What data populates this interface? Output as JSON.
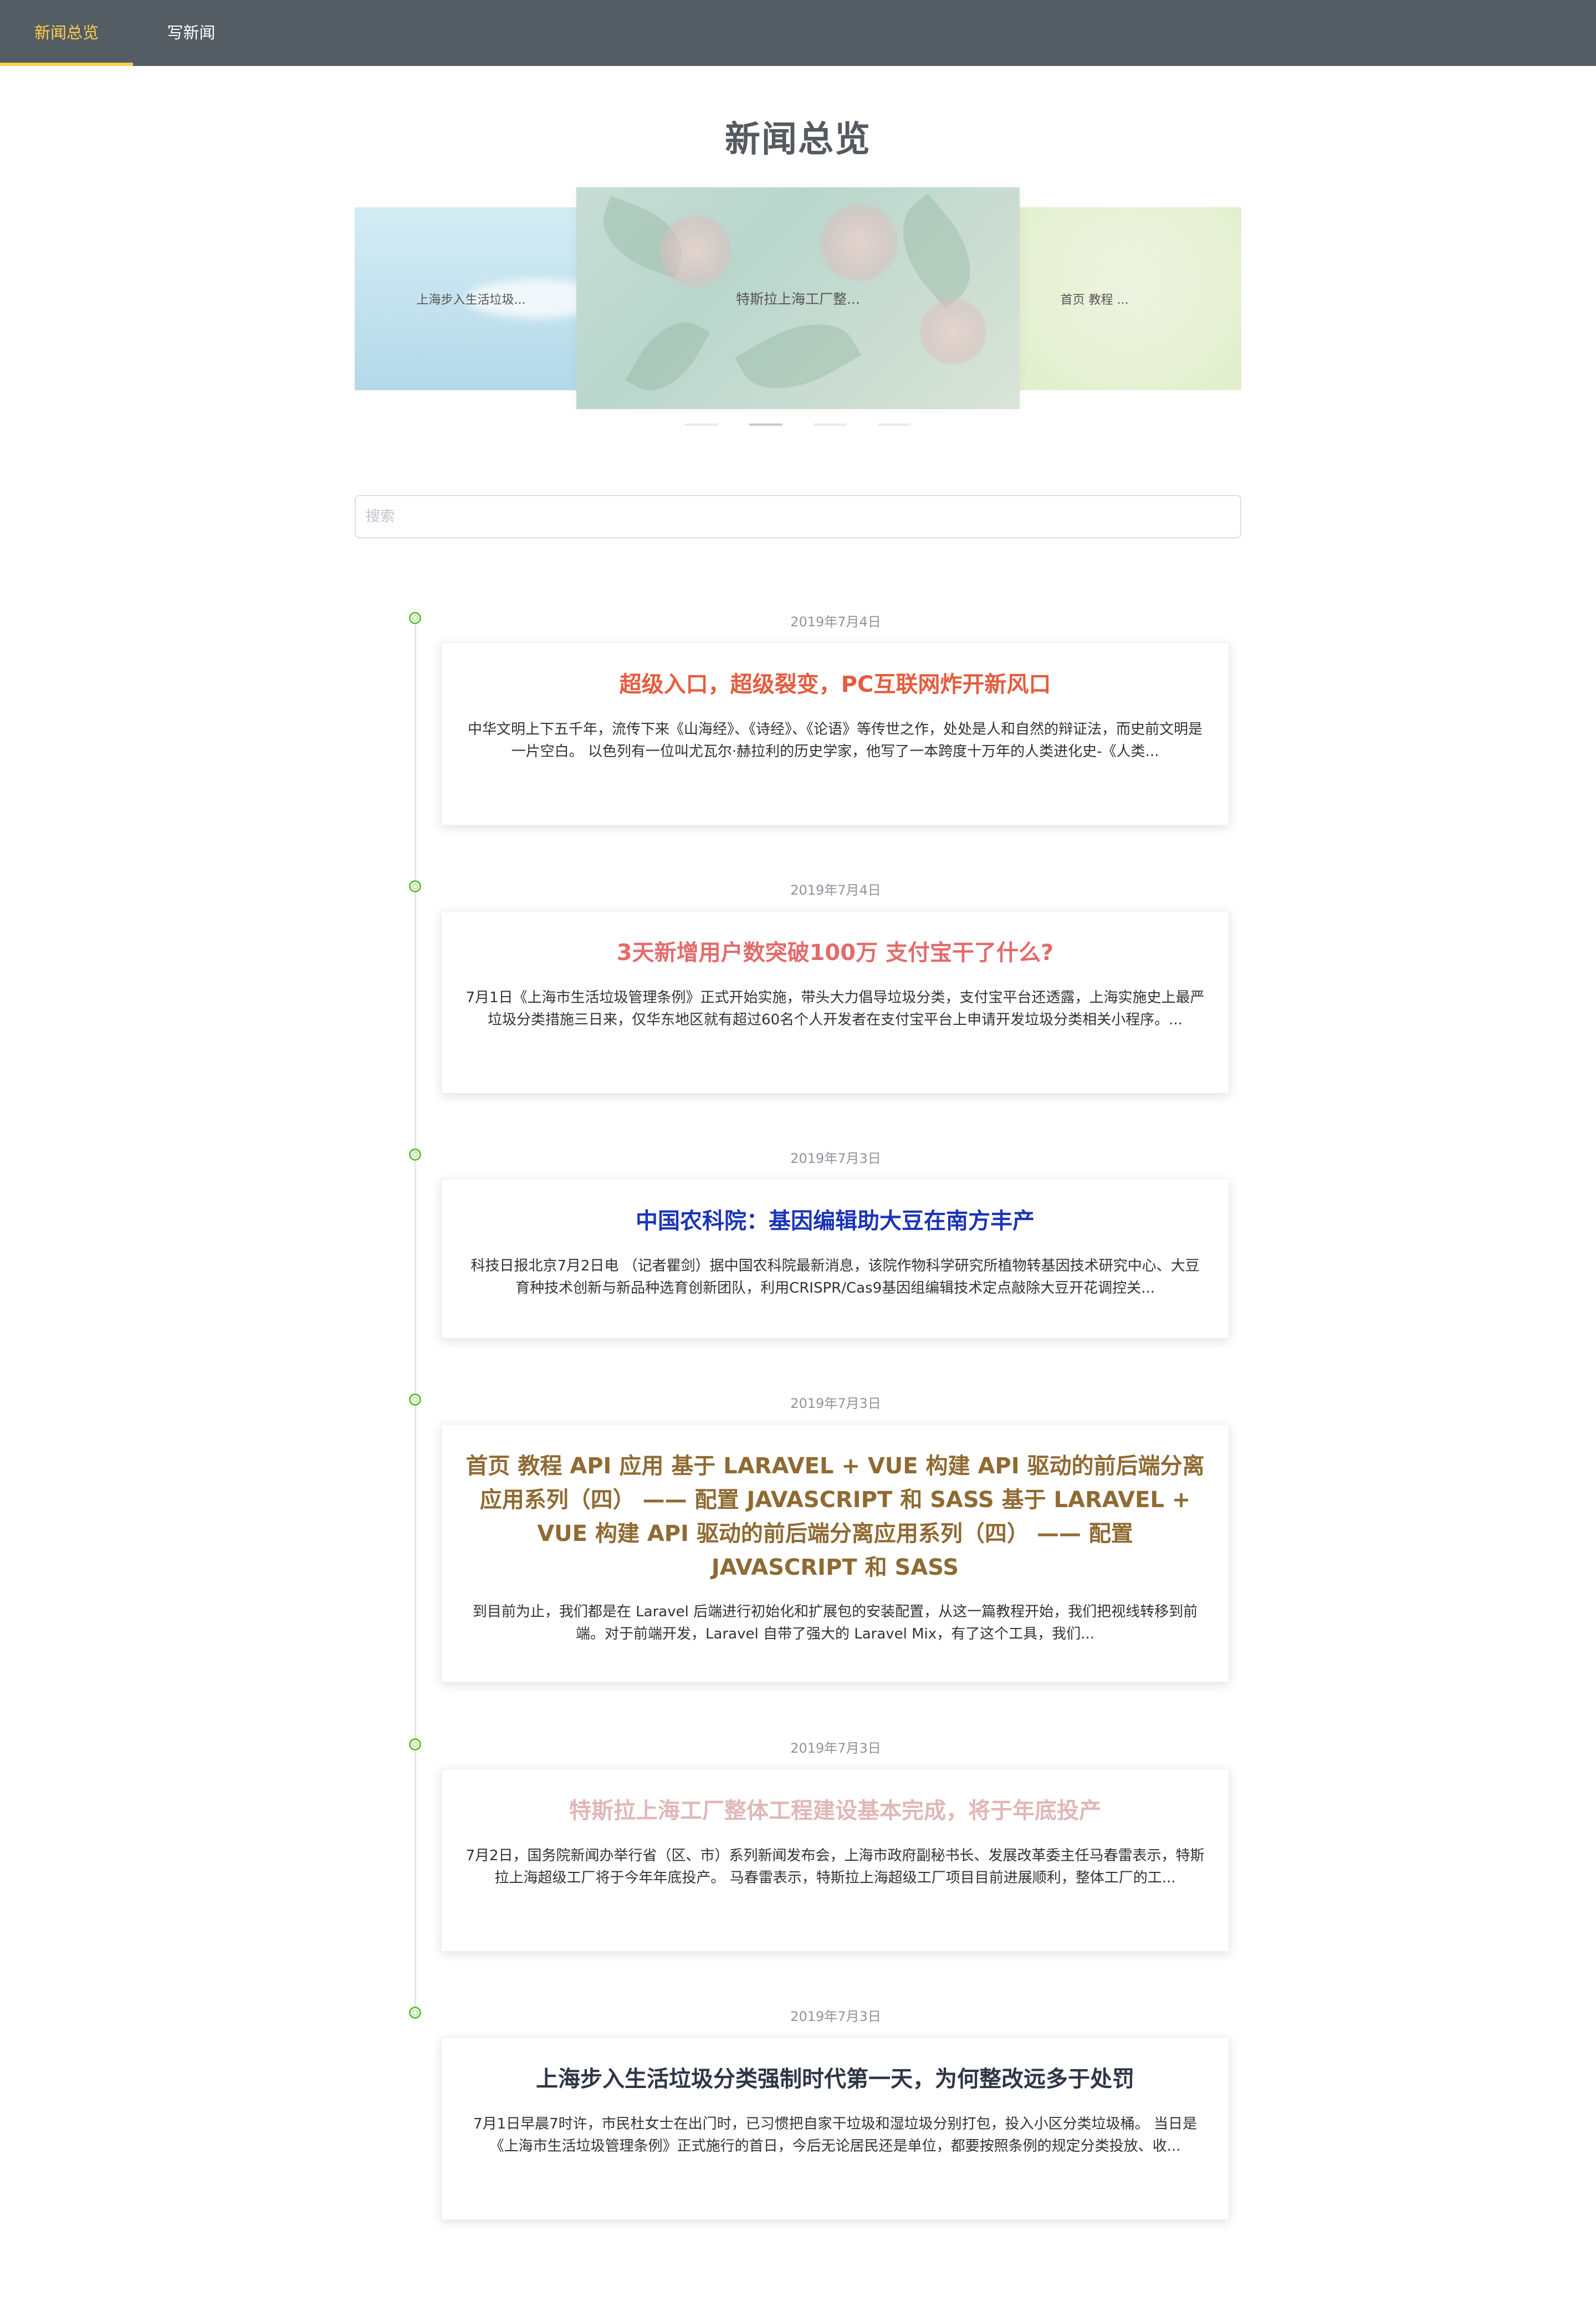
{
  "nav": {
    "items": [
      {
        "label": "新闻总览",
        "active": true
      },
      {
        "label": "写新闻",
        "active": false
      }
    ]
  },
  "page": {
    "title": "新闻总览"
  },
  "carousel": {
    "slides": [
      {
        "caption": "上海步入生活垃圾..."
      },
      {
        "caption": "特斯拉上海工厂整..."
      },
      {
        "caption": "首页 教程 ..."
      }
    ],
    "indicator_count": 4,
    "active_index": 1
  },
  "search": {
    "placeholder": "搜索",
    "value": ""
  },
  "timeline": [
    {
      "date": "2019年7月4日",
      "title": "超级入口，超级裂变，PC互联网炸开新风口",
      "title_color": "#e45c3f",
      "summary": "中华文明上下五千年，流传下来《山海经》、《诗经》、《论语》等传世之作，处处是人和自然的辩证法，而史前文明是一片空白。 以色列有一位叫尤瓦尔·赫拉利的历史学家，他写了一本跨度十万年的人类进化史-《人类..."
    },
    {
      "date": "2019年7月4日",
      "title": "3天新增用户数突破100万 支付宝干了什么?",
      "title_color": "#e36b6b",
      "summary": "7月1日《上海市生活垃圾管理条例》正式开始实施，带头大力倡导垃圾分类，支付宝平台还透露，上海实施史上最严垃圾分类措施三日来，仅华东地区就有超过60名个人开发者在支付宝平台上申请开发垃圾分类相关小程序。..."
    },
    {
      "date": "2019年7月3日",
      "title": "中国农科院：基因编辑助大豆在南方丰产",
      "title_color": "#1b34b7",
      "summary": "科技日报北京7月2日电 （记者瞿剑）据中国农科院最新消息，该院作物科学研究所植物转基因技术研究中心、大豆育种技术创新与新品种选育创新团队，利用CRISPR/Cas9基因组编辑技术定点敲除大豆开花调控关..."
    },
    {
      "date": "2019年7月3日",
      "title": "首页 教程 API 应用 基于 LARAVEL + VUE 构建 API 驱动的前后端分离应用系列（四） —— 配置 JAVASCRIPT 和 SASS 基于 LARAVEL + VUE 构建 API 驱动的前后端分离应用系列（四） —— 配置 JAVASCRIPT 和 SASS",
      "title_color": "#8f6a32",
      "summary": "到目前为止，我们都是在 Laravel 后端进行初始化和扩展包的安装配置，从这一篇教程开始，我们把视线转移到前端。对于前端开发，Laravel 自带了强大的 Laravel Mix，有了这个工具，我们..."
    },
    {
      "date": "2019年7月3日",
      "title": "特斯拉上海工厂整体工程建设基本完成，将于年底投产",
      "title_color": "#e0b7b7",
      "summary": "7月2日，国务院新闻办举行省（区、市）系列新闻发布会，上海市政府副秘书长、发展改革委主任马春雷表示，特斯拉上海超级工厂将于今年年底投产。 马春雷表示，特斯拉上海超级工厂项目目前进展顺利，整体工厂的工..."
    },
    {
      "date": "2019年7月3日",
      "title": "上海步入生活垃圾分类强制时代第一天，为何整改远多于处罚",
      "title_color": "#2e3545",
      "summary": "7月1日早晨7时许，市民杜女士在出门时，已习惯把自家干垃圾和湿垃圾分别打包，投入小区分类垃圾桶。 当日是《上海市生活垃圾管理条例》正式施行的首日，今后无论居民还是单位，都要按照条例的规定分类投放、收..."
    }
  ]
}
